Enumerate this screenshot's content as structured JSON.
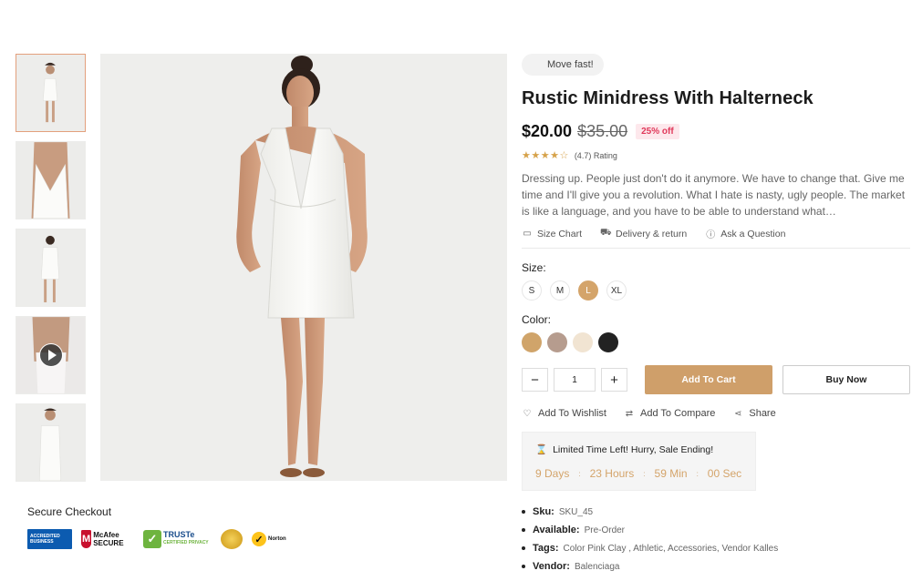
{
  "badge": "Move fast!",
  "product": {
    "title": "Rustic Minidress With Halterneck",
    "price": "$20.00",
    "old_price": "$35.00",
    "discount": "25% off",
    "stars": "★★★★☆",
    "rating_text": "(4.7) Rating",
    "description": "Dressing up. People just don't do it anymore. We have to change that. Give me time and I'll give you a revolution. What I hate is nasty, ugly people. The market is like a language, and you have to be able to understand what…"
  },
  "links": {
    "size_chart": "Size Chart",
    "delivery": "Delivery & return",
    "question": "Ask a Question"
  },
  "size": {
    "label": "Size:",
    "options": [
      "S",
      "M",
      "L",
      "XL"
    ],
    "selected": "L"
  },
  "color": {
    "label": "Color:",
    "swatches": [
      "#d0a46a",
      "#b69c8e",
      "#f1e4d2",
      "#222222"
    ]
  },
  "cart": {
    "minus": "−",
    "quantity": "1",
    "plus": "+",
    "add_to_cart": "Add To Cart",
    "buy_now": "Buy Now"
  },
  "actions": {
    "wishlist": "Add To Wishlist",
    "compare": "Add To Compare",
    "share": "Share"
  },
  "timer": {
    "heading": "Limited Time Left! Hurry, Sale Ending!",
    "days": "9 Days",
    "hours": "23 Hours",
    "minutes": "59 Min",
    "seconds": "00 Sec"
  },
  "meta": {
    "sku_label": "Sku:",
    "sku": "SKU_45",
    "available_label": "Available:",
    "available": "Pre-Order",
    "tags_label": "Tags:",
    "tags": "Color Pink Clay , Athletic, Accessories, Vendor Kalles",
    "vendor_label": "Vendor:",
    "vendor": "Balenciaga"
  },
  "secure": {
    "title": "Secure Checkout",
    "bbb": "ACCREDITED BUSINESS",
    "mcafee": "McAfee SECURE",
    "truste": "TRUSTe",
    "truste_sub": "CERTIFIED PRIVACY",
    "norton": "Norton"
  }
}
